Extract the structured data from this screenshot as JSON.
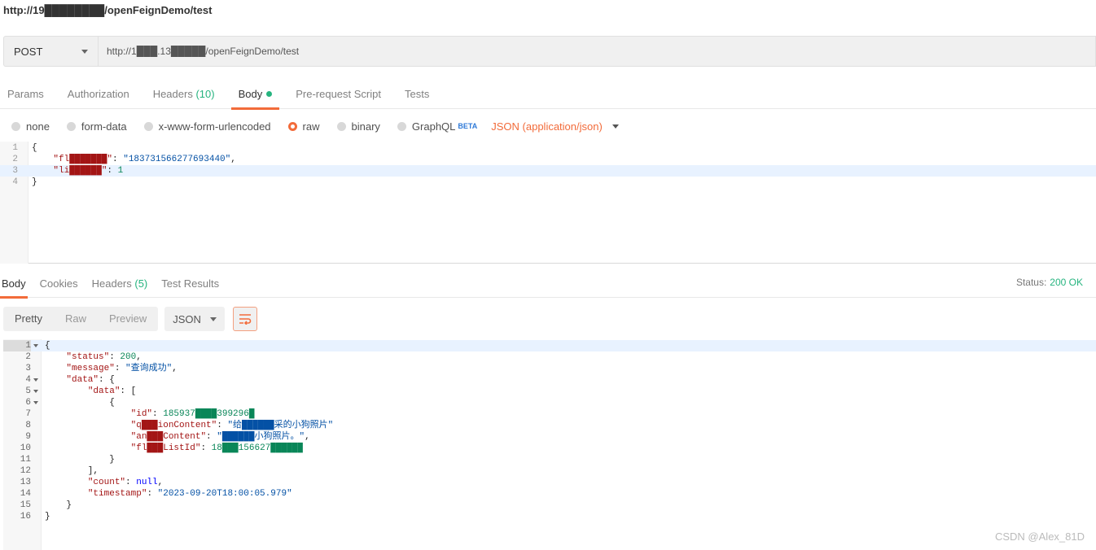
{
  "request": {
    "title_url": "http://19████████/openFeignDemo/test",
    "method": "POST",
    "url_value": "http://1███.13█████/openFeignDemo/test"
  },
  "request_tabs": [
    {
      "label": "Params",
      "count": ""
    },
    {
      "label": "Authorization",
      "count": ""
    },
    {
      "label": "Headers",
      "count": "(10)"
    },
    {
      "label": "Body",
      "count": ""
    },
    {
      "label": "Pre-request Script",
      "count": ""
    },
    {
      "label": "Tests",
      "count": ""
    }
  ],
  "body_types": {
    "none": "none",
    "form_data": "form-data",
    "urlencoded": "x-www-form-urlencoded",
    "raw": "raw",
    "binary": "binary",
    "graphql": "GraphQL",
    "beta": "BETA",
    "content_type": "JSON (application/json)"
  },
  "request_body": [
    {
      "n": "1",
      "text": "{"
    },
    {
      "n": "2",
      "key": "\"fl███████\"",
      "value": "\"183731566277693440\"",
      "tail": ","
    },
    {
      "n": "3",
      "key": "\"li██████\"",
      "value": "1",
      "tail": ""
    },
    {
      "n": "4",
      "text": "}"
    }
  ],
  "response_tabs": [
    {
      "label": "Body",
      "count": ""
    },
    {
      "label": "Cookies",
      "count": ""
    },
    {
      "label": "Headers",
      "count": "(5)"
    },
    {
      "label": "Test Results",
      "count": ""
    }
  ],
  "status": {
    "label": "Status:",
    "value": "200 OK"
  },
  "view_modes": [
    "Pretty",
    "Raw",
    "Preview"
  ],
  "format": "JSON",
  "response_body": [
    {
      "n": "1",
      "fold": true,
      "text": "{"
    },
    {
      "n": "2",
      "text": "    ",
      "key": "\"status\"",
      "sep": ": ",
      "num": "200",
      "tail": ","
    },
    {
      "n": "3",
      "text": "    ",
      "key": "\"message\"",
      "sep": ": ",
      "str": "\"查询成功\"",
      "tail": ","
    },
    {
      "n": "4",
      "fold": true,
      "text": "    ",
      "key": "\"data\"",
      "sep": ": ",
      "tail": "{"
    },
    {
      "n": "5",
      "fold": true,
      "text": "        ",
      "key": "\"data\"",
      "sep": ": ",
      "tail": "["
    },
    {
      "n": "6",
      "fold": true,
      "text": "            {"
    },
    {
      "n": "7",
      "text": "                ",
      "key": "\"id\"",
      "sep": ": ",
      "num": "185937████399296█"
    },
    {
      "n": "8",
      "text": "                ",
      "key": "\"q███ionContent\"",
      "sep": ": ",
      "str": "\"给██████采的小狗照片\""
    },
    {
      "n": "9",
      "text": "                ",
      "key": "\"an███Content\"",
      "sep": ": ",
      "str": "\"██████小狗照片。\"",
      "tail": ","
    },
    {
      "n": "10",
      "text": "                ",
      "key": "\"fl███ListId\"",
      "sep": ": ",
      "num": "18███156627██████"
    },
    {
      "n": "11",
      "text": "            }"
    },
    {
      "n": "12",
      "text": "        ],"
    },
    {
      "n": "13",
      "text": "        ",
      "key": "\"count\"",
      "sep": ": ",
      "kw": "null",
      "tail": ","
    },
    {
      "n": "14",
      "text": "        ",
      "key": "\"timestamp\"",
      "sep": ": ",
      "str": "\"2023-09-20T18:00:05.979\""
    },
    {
      "n": "15",
      "text": "    }"
    },
    {
      "n": "16",
      "text": "}"
    }
  ],
  "watermark": "CSDN @Alex_81D",
  "colors": {
    "accent": "#f26b3a",
    "success": "#26b47f",
    "beta": "#2f7ad8"
  }
}
